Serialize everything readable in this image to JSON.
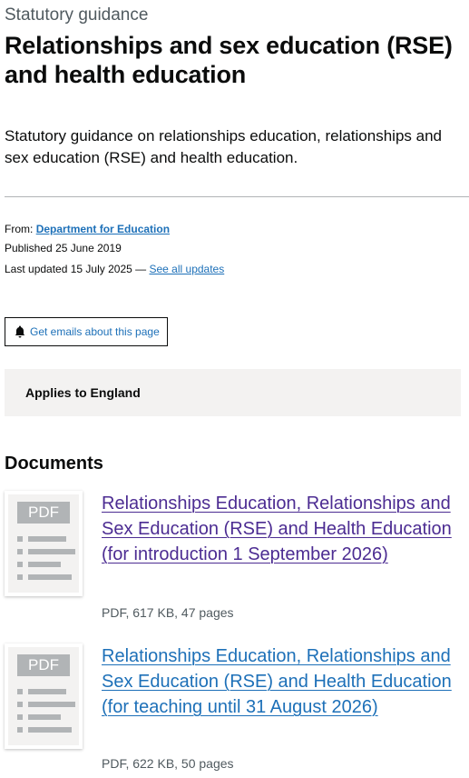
{
  "header": {
    "document_type": "Statutory guidance",
    "title": "Relationships and sex education (RSE) and health education",
    "summary": "Statutory guidance on relationships education, relationships and sex education (RSE) and health education."
  },
  "metadata": {
    "from_label": "From:",
    "from_org": "Department for Education",
    "published_label": "Published",
    "published_date": "25 June 2019",
    "updated_label": "Last updated",
    "updated_date": "15 July 2025",
    "separator": "—",
    "see_all_updates": "See all updates"
  },
  "email_button": {
    "label": "Get emails about this page",
    "icon": "bell-icon"
  },
  "applies_to": "Applies to England",
  "documents_heading": "Documents",
  "documents": [
    {
      "title": "Relationships Education, Relationships and Sex Education (RSE) and Health Education (for introduction 1 September 2026)",
      "meta": "PDF, 617 KB, 47 pages",
      "thumbnail_label": "PDF"
    },
    {
      "title": "Relationships Education, Relationships and Sex Education (RSE) and Health Education (for teaching until 31 August 2026)",
      "meta": "PDF, 622 KB, 50 pages",
      "thumbnail_label": "PDF"
    }
  ],
  "colors": {
    "link": "#1d70b8",
    "visited_link": "#4c2c92",
    "text": "#0b0c0c",
    "secondary_text": "#505a5f",
    "panel": "#f3f2f1"
  }
}
